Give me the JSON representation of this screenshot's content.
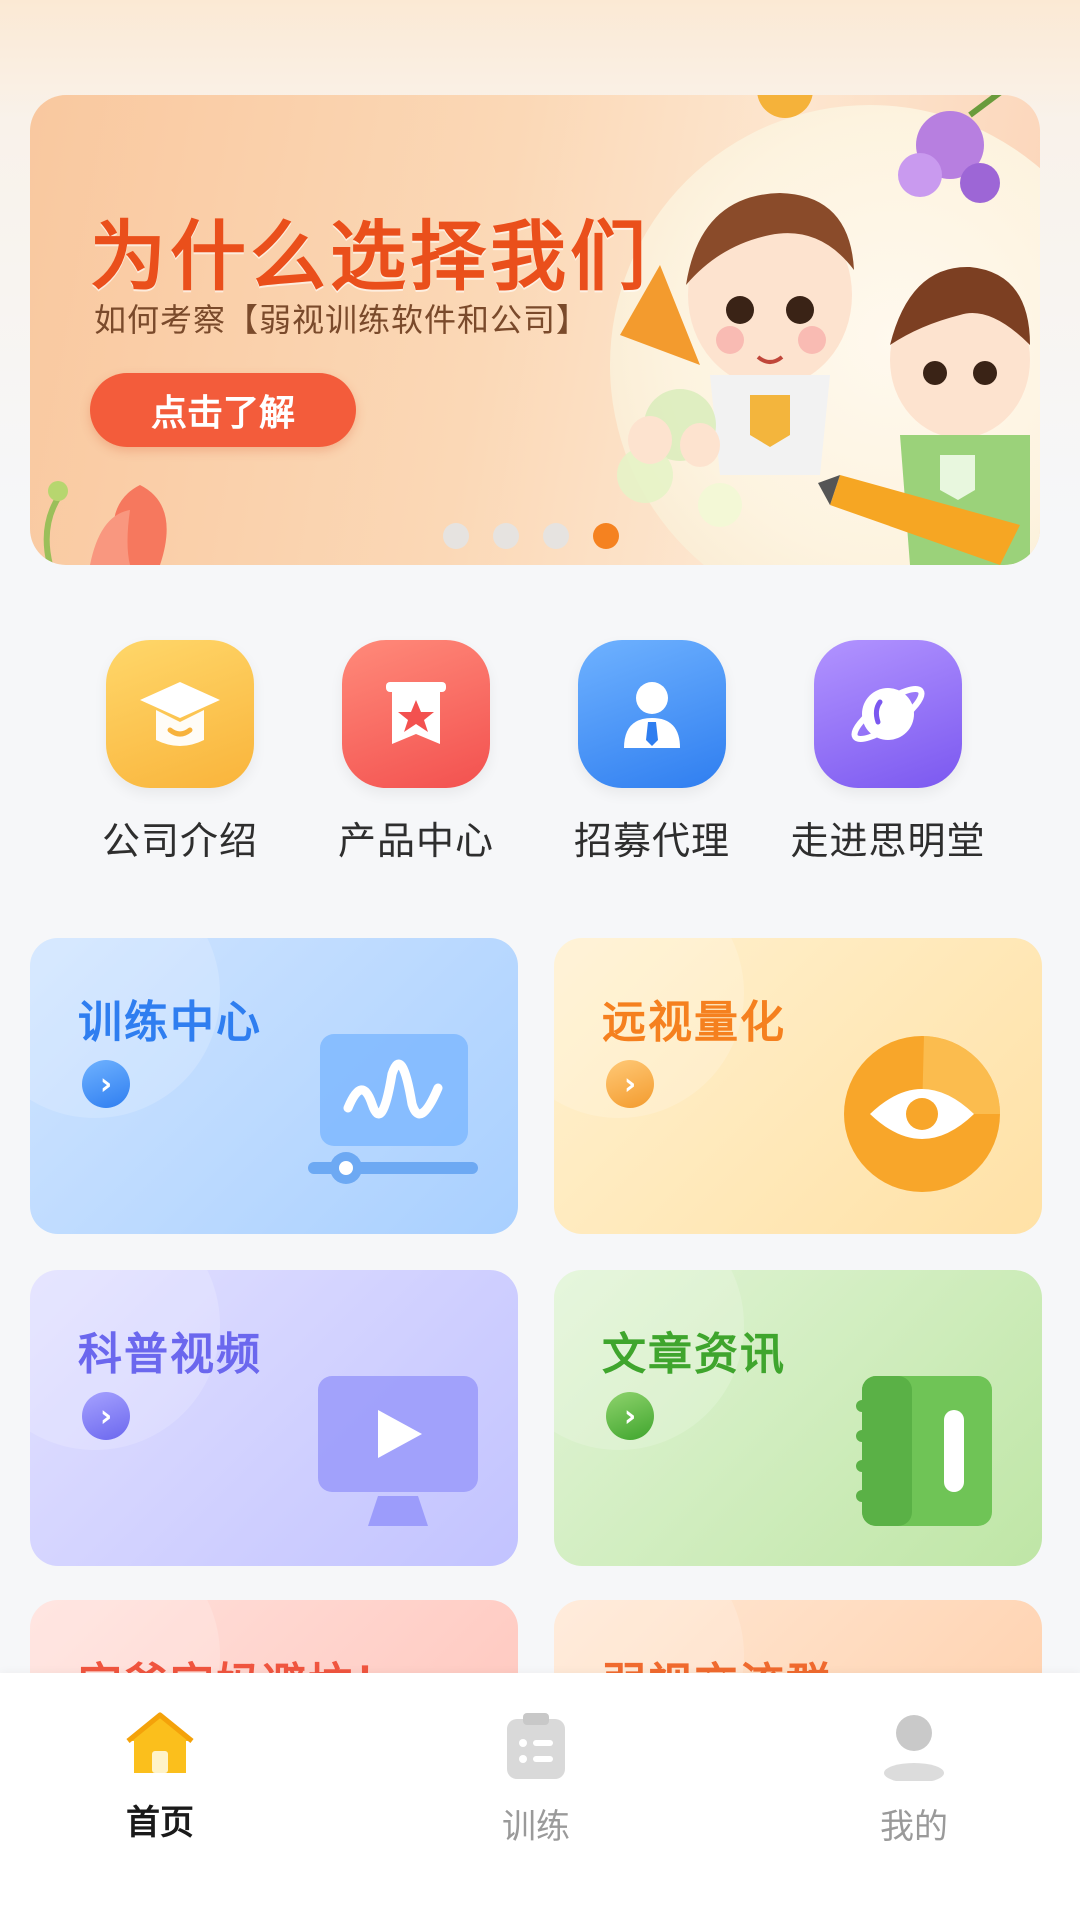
{
  "banner": {
    "title": "为什么选择我们",
    "subtitle": "如何考察【弱视训练软件和公司】",
    "cta_label": "点击了解",
    "page_count": 4,
    "active_page": 4
  },
  "quick_entries": [
    {
      "label": "公司介绍",
      "icon": "graduation-cap-icon",
      "color": "#fbc24c"
    },
    {
      "label": "产品中心",
      "icon": "star-badge-icon",
      "color": "#f75b5b"
    },
    {
      "label": "招募代理",
      "icon": "person-icon",
      "color": "#3e8ef7"
    },
    {
      "label": "走进思明堂",
      "icon": "planet-icon",
      "color": "#8a66f3"
    }
  ],
  "cards": [
    {
      "title": "训练中心",
      "title_color": "#2f7ef0",
      "icon": "waveform-monitor-icon"
    },
    {
      "title": "远视量化",
      "title_color": "#f5801f",
      "icon": "eye-icon"
    },
    {
      "title": "科普视频",
      "title_color": "#6b67ee",
      "icon": "video-play-icon"
    },
    {
      "title": "文章资讯",
      "title_color": "#3fa52d",
      "icon": "notebook-icon"
    },
    {
      "title": "宝爸宝妈避坑！",
      "title_color": "#f0553f",
      "icon": ""
    },
    {
      "title": "弱视交流群",
      "title_color": "#f06a2e",
      "icon": ""
    }
  ],
  "bottom_nav": {
    "items": [
      {
        "label": "首页",
        "icon": "home-icon",
        "active": true
      },
      {
        "label": "训练",
        "icon": "clipboard-icon",
        "active": false
      },
      {
        "label": "我的",
        "icon": "user-icon",
        "active": false
      }
    ],
    "active_color": "#1a1a1a",
    "inactive_color": "#9a9a9a"
  }
}
